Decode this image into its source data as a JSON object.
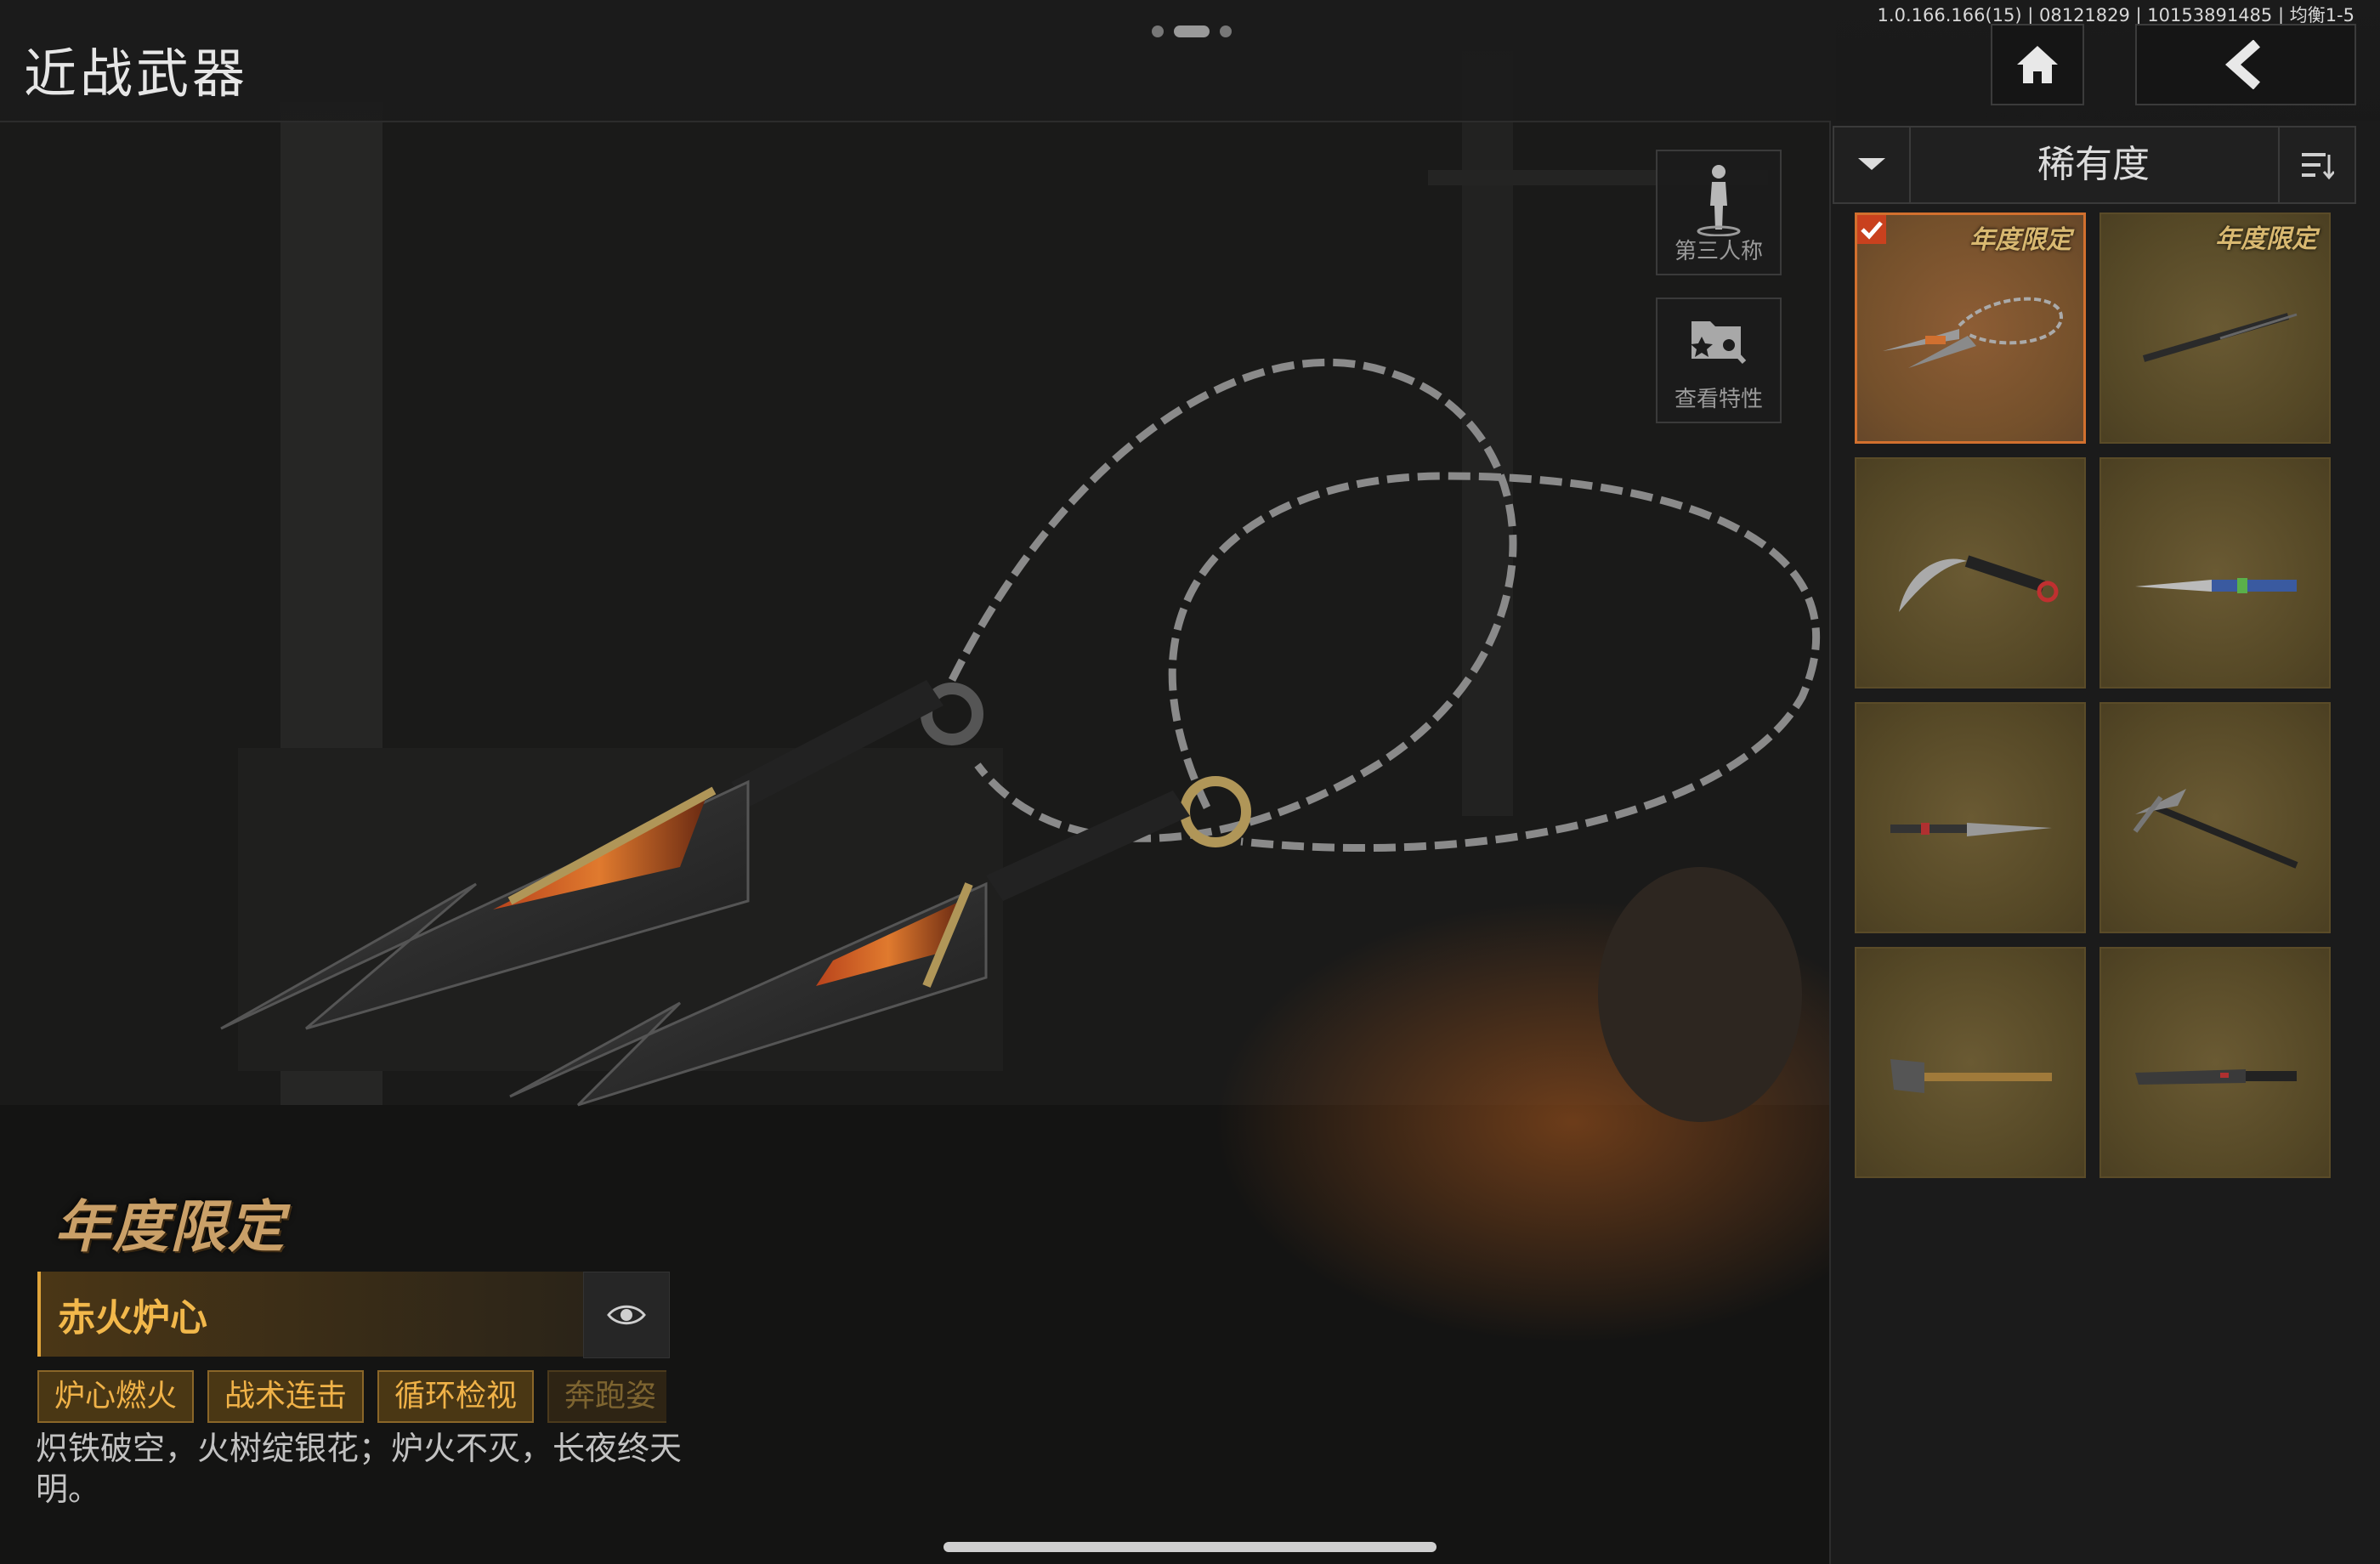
{
  "header": {
    "title": "近战武器",
    "version": "1.0.166.166(15) | 08121829 | 10153891485 | 均衡1-5",
    "home_icon": "home-icon",
    "back_icon": "back-arrow-icon"
  },
  "side_buttons": [
    {
      "label": "第三人称",
      "icon": "person-view-icon"
    },
    {
      "label": "查看特性",
      "icon": "view-features-icon"
    }
  ],
  "sort": {
    "label": "稀有度",
    "dropdown_icon": "chevron-down-icon",
    "sort_icon": "sort-list-icon"
  },
  "grid": [
    {
      "badge": "年度限定",
      "selected": true,
      "weapon": "chain-dart-pair"
    },
    {
      "badge": "年度限定",
      "selected": false,
      "weapon": "chain-blade"
    },
    {
      "badge": "",
      "selected": false,
      "weapon": "karambit"
    },
    {
      "badge": "",
      "selected": false,
      "weapon": "butterfly-knife"
    },
    {
      "badge": "",
      "selected": false,
      "weapon": "combat-knife"
    },
    {
      "badge": "",
      "selected": false,
      "weapon": "ice-axe"
    },
    {
      "badge": "",
      "selected": false,
      "weapon": "shovel"
    },
    {
      "badge": "",
      "selected": false,
      "weapon": "machete"
    }
  ],
  "detail": {
    "limited_label": "年度限定",
    "name": "赤火炉心",
    "eye_icon": "eye-icon",
    "tags": [
      "炉心燃火",
      "战术连击",
      "循环检视",
      "奔跑姿"
    ],
    "description": "炽铁破空，火树绽银花；炉火不灭，长夜终天明。"
  },
  "colors": {
    "accent": "#e0a43b",
    "selected_border": "#d2702e",
    "tile_bg": "#554826"
  }
}
